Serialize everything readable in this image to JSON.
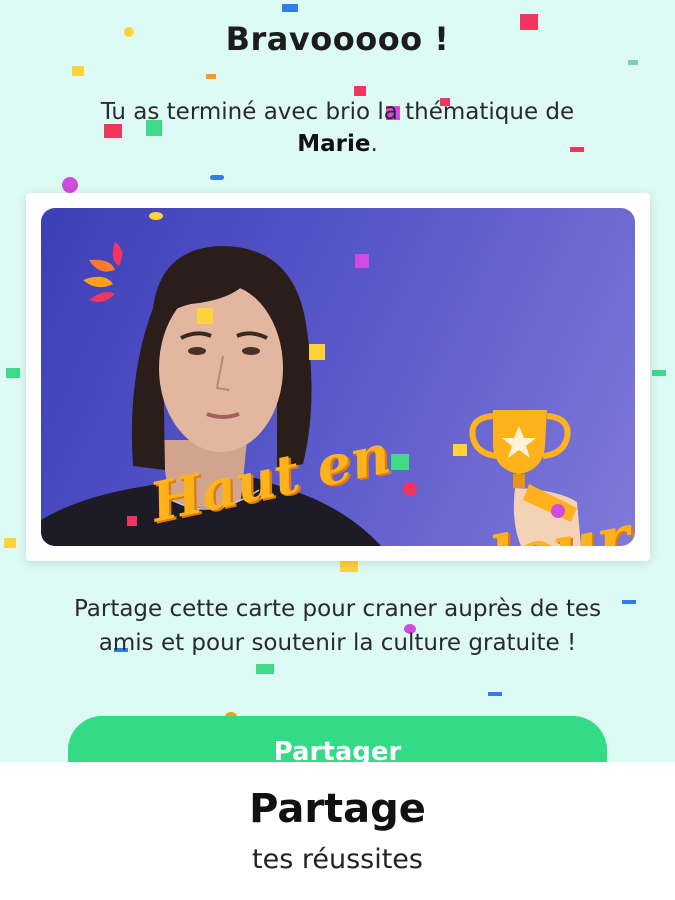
{
  "header": {
    "title": "Bravooooo !"
  },
  "intro": {
    "line1": "Tu as terminé avec brio la thématique de",
    "name": "Marie",
    "end": "."
  },
  "card": {
    "title_line1": "Haut en",
    "title_line2": "Couleur"
  },
  "share": {
    "text_line1": "Partage cette carte pour craner auprès de tes",
    "text_line2": "amis et pour soutenir la culture gratuite !"
  },
  "share_button": {
    "label": "Partager"
  },
  "caption": {
    "title": "Partage",
    "subtitle": "tes réussites"
  },
  "colors": {
    "background": "#ddfaf4",
    "button": "#34db86",
    "card_gradient_start": "#3d3fb7",
    "card_gradient_end": "#7f79d8",
    "logo": "#ffb21c"
  }
}
